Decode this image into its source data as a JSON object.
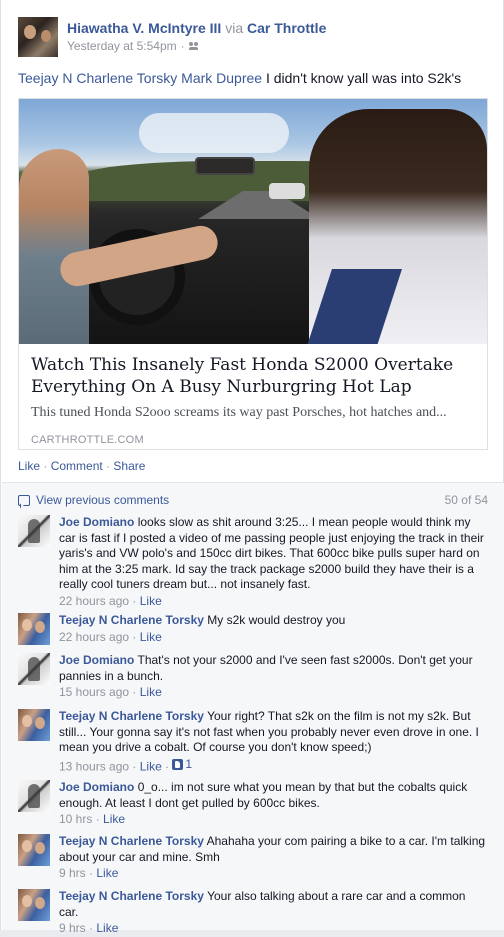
{
  "post": {
    "author": "Hiawatha V. McIntyre III",
    "via_label": "via",
    "via_app": "Car Throttle",
    "timestamp": "Yesterday at 5:54pm",
    "meta_sep": "·",
    "audience_icon": "friends-icon",
    "text_tags": [
      "Teejay N Charlene Torsky",
      "Mark Dupree"
    ],
    "text_body": "I didn't know yall was into S2k's"
  },
  "link_card": {
    "title": "Watch This Insanely Fast Honda S2000 Overtake Everything On A Busy Nurburgring Hot Lap",
    "description": "This tuned Honda S2ooo screams its way past Porsches, hot hatches and...",
    "domain": "CARTHROTTLE.COM"
  },
  "actions": {
    "like": "Like",
    "comment": "Comment",
    "share": "Share",
    "sep": "·"
  },
  "comments_section": {
    "view_previous": "View previous comments",
    "count": "50 of 54",
    "comments": [
      {
        "author": "Joe Domiano",
        "text": "looks slow as shit around 3:25... I mean people would think my car is fast if I posted a video of me passing people just enjoying the track in their yaris's and VW polo's and 150cc dirt bikes. That 600cc bike pulls super hard on him at the 3:25 mark. Id say the track package s2000 build they have their is a really cool tuners dream but... not insanely fast.",
        "time": "22 hours ago",
        "like": "Like"
      },
      {
        "author": "Teejay N Charlene Torsky",
        "text": "My s2k would destroy you",
        "time": "22 hours ago",
        "like": "Like"
      },
      {
        "author": "Joe Domiano",
        "text": "That's not your s2000 and I've seen fast s2000s. Don't get your pannies in a bunch.",
        "time": "15 hours ago",
        "like": "Like"
      },
      {
        "author": "Teejay N Charlene Torsky",
        "text": "Your right? That s2k on the film is not my s2k. But still... Your gonna say it's not fast when you probably never even drove in one. I mean you drive a cobalt. Of course you don't know speed;)",
        "time": "13 hours ago",
        "like": "Like",
        "likes": "1"
      },
      {
        "author": "Joe Domiano",
        "text": "0_o... im not sure what you mean by that but the cobalts quick enough. At least I dont get pulled by 600cc bikes.",
        "time": "10 hrs",
        "like": "Like"
      },
      {
        "author": "Teejay N Charlene Torsky",
        "text": "Ahahaha your com pairing a bike to a car. I'm talking about your car and mine. Smh",
        "time": "9 hrs",
        "like": "Like"
      },
      {
        "author": "Teejay N Charlene Torsky",
        "text": "Your also talking about a rare car and a common car.",
        "time": "9 hrs",
        "like": "Like"
      }
    ]
  }
}
